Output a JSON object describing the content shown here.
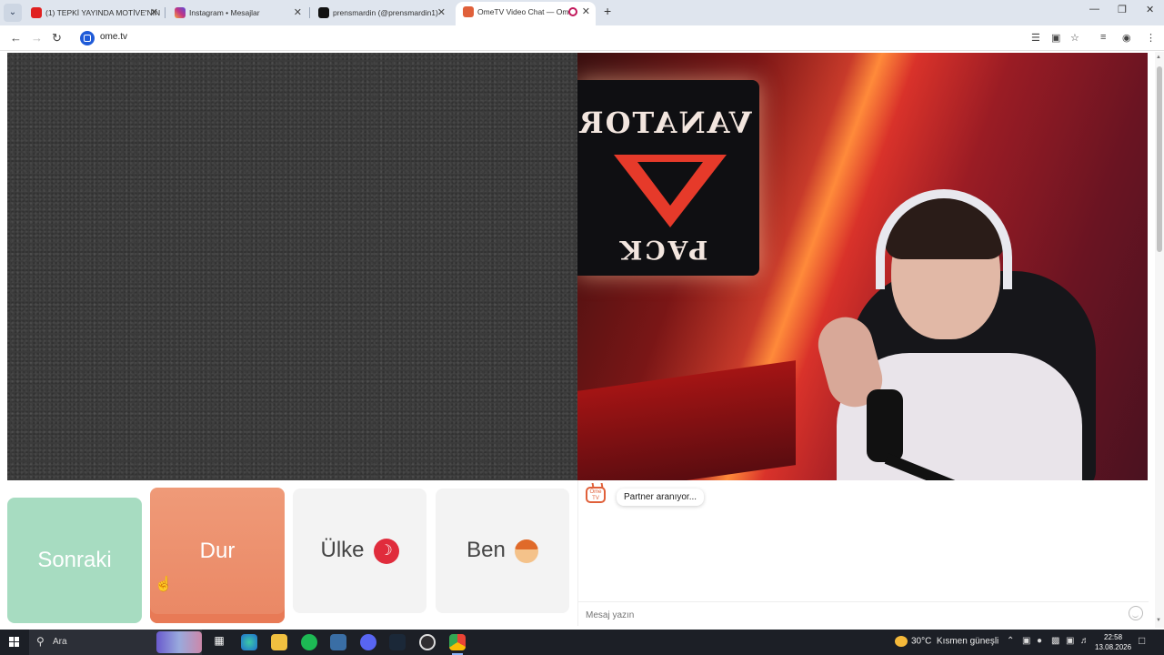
{
  "browser": {
    "tabs": [
      {
        "title": "(1) TEPKİ YAYINDA MOTİVE'NİN",
        "favicon": "youtube-icon",
        "color": "#e02020"
      },
      {
        "title": "Instagram • Mesajlar",
        "favicon": "instagram-icon",
        "color": "#c13584"
      },
      {
        "title": "prensmardin (@prensmardin1)",
        "favicon": "tiktok-icon",
        "color": "#111111"
      },
      {
        "title": "OmeTV Video Chat — Ome",
        "favicon": "ometv-icon",
        "color": "#e0603a",
        "active": true
      }
    ],
    "url": "ome.tv"
  },
  "controls": {
    "next_label": "Sonraki",
    "stop_label": "Dur",
    "country_label": "Ülke",
    "country_flag": "turkey-flag-icon",
    "me_label": "Ben",
    "me_icon": "boy-emoji-icon"
  },
  "chat": {
    "status_message": "Partner aranıyor...",
    "input_placeholder": "Mesaj yazın"
  },
  "webcam_overlay": {
    "sign_top": "VANATOR",
    "sign_bottom": "PACK"
  },
  "taskbar": {
    "search_placeholder": "Ara",
    "weather_temp": "30°C",
    "weather_text": "Kısmen güneşli",
    "time": "22:58",
    "date": "13.08.2026"
  },
  "colors": {
    "next_button": "#a7dcc1",
    "stop_button": "#ea8764",
    "neutral_button": "#f3f3f3"
  }
}
